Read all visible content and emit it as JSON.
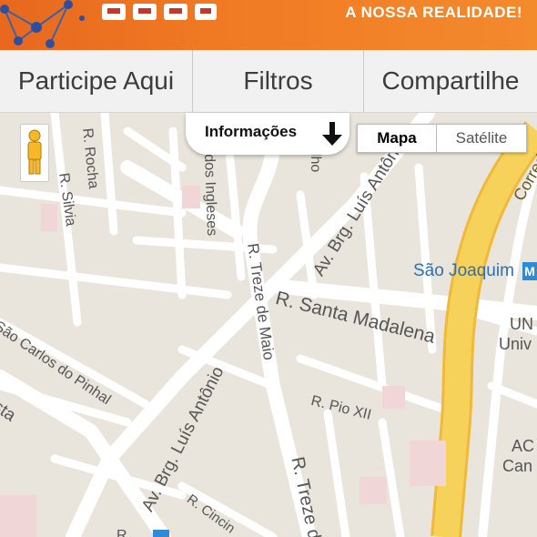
{
  "banner": {
    "tagline": "A NOSSA REALIDADE!",
    "logo_icon": "network-logo-icon"
  },
  "tabs": [
    {
      "label": "Participe Aqui"
    },
    {
      "label": "Filtros"
    },
    {
      "label": "Compartilhe"
    }
  ],
  "map": {
    "info_label": "Informações",
    "info_icon": "arrow-down-icon",
    "map_type": {
      "map": "Mapa",
      "satellite": "Satélite",
      "selected": "Mapa"
    },
    "pegman_icon": "pegman-icon",
    "metro_icon": "metro-icon",
    "street_labels": {
      "rocha": "R. Rocha",
      "silvia": "R. Silvia",
      "ingleses": "dos Ingleses",
      "trezo_maio_1": "R. Treze de Maio",
      "trezo_maio_2": "R. Treze d",
      "brg_luis_1": "Av. Brg. Luís Antônio",
      "brg_luis_2": "Av. Brg. Luís Antônio",
      "santa_madalena": "R. Santa Madalena",
      "pio_xii": "R. Pio XII",
      "carlos_pinhal": "São Carlos do Pinhal",
      "sta": "sta",
      "cincin": "R. Cincin",
      "corred": "Corred",
      "galho": "alho"
    },
    "place_labels": {
      "sao_joaquim": "São Joaquim",
      "un": "UN",
      "univ": "Univ",
      "ac": "AC",
      "can": "Can",
      "bottom_partial": "R"
    }
  },
  "colors": {
    "banner_orange": "#f07a24",
    "map_bg": "#e9e5dc",
    "road": "#ffffff",
    "highway": "#f7d25a",
    "metro_blue": "#2f8ad8"
  }
}
